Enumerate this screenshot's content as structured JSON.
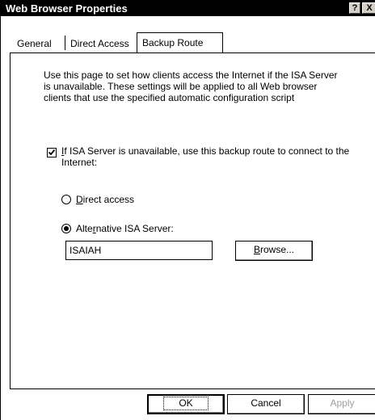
{
  "window": {
    "title": "Web Browser Properties",
    "help_glyph": "?",
    "close_glyph": "X"
  },
  "tabs": [
    {
      "label": "General",
      "active": false
    },
    {
      "label": "Direct Access",
      "active": false
    },
    {
      "label": "Backup Route",
      "active": true
    }
  ],
  "page": {
    "intro": "Use this page to set how clients access the Internet if the ISA Server is unavailable. These settings will be applied to all Web browser clients that use  the specified automatic configuration script",
    "backup_checkbox": {
      "checked": true,
      "mnemonic": "I",
      "label_rest": "f ISA Server is unavailable, use this backup route to connect to the Internet:"
    },
    "direct_access": {
      "selected": false,
      "mnemonic": "D",
      "label_rest": "irect access"
    },
    "alternative": {
      "selected": true,
      "label_start": "Alte",
      "mnemonic": "r",
      "label_end": "native ISA Server:"
    },
    "server_value": "ISAIAH",
    "browse_button": {
      "mnemonic": "B",
      "label_rest": "rowse..."
    }
  },
  "footer": {
    "ok": "OK",
    "cancel": "Cancel",
    "apply": "Apply"
  }
}
